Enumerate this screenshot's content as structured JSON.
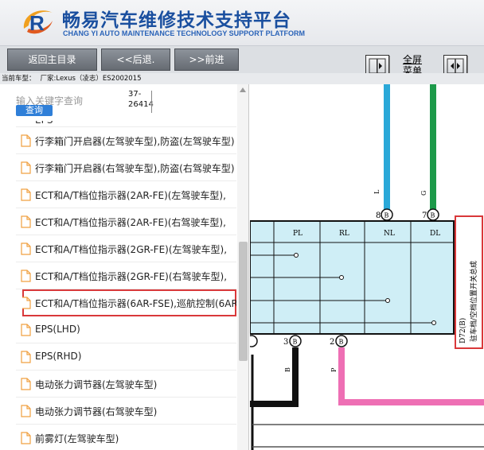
{
  "header": {
    "title_cn": "畅易汽车维修技术支持平台",
    "title_en": "CHANG YI AUTO MAINTENANCE TECHNOLOGY SUPPORT PLATFORM"
  },
  "toolbar": {
    "back_home": "返回主目录",
    "back": "<<后退.",
    "forward": ">>前进",
    "fullscreen_line1": "全屏",
    "fullscreen_line2": "菜单"
  },
  "vehicle": {
    "label": "当前车型：",
    "maker": "厂家:Lexus（凌志）ES2002015"
  },
  "search": {
    "placeholder": "输入关键字查询",
    "value_line1": "37-",
    "value_line2": "26414",
    "button": "查询"
  },
  "list_items": [
    "行李箱门开启器(左驾驶车型),防盗(左驾驶车型)",
    "行李箱门开启器(右驾驶车型),防盗(右驾驶车型)",
    "ECT和A/T档位指示器(2AR-FE)(左驾驶车型),",
    "ECT和A/T档位指示器(2AR-FE)(右驾驶车型),",
    "ECT和A/T档位指示器(2GR-FE)(左驾驶车型),",
    "ECT和A/T档位指示器(2GR-FE)(右驾驶车型),",
    "ECT和A/T档位指示器(6AR-FSE),巡航控制(6AR",
    "EPS(LHD)",
    "EPS(RHD)",
    "电动张力调节器(左驾驶车型)",
    "电动张力调节器(右驾驶车型)",
    "前雾灯(左驾驶车型)"
  ],
  "selected_index": 6,
  "diagram": {
    "pin8": "8",
    "pin7": "7",
    "pin3": "3",
    "pin2": "2",
    "pin_circle": "B",
    "wire_blue": "L",
    "wire_green": "G",
    "wire_black": "B",
    "wire_pink": "P",
    "col_pl": "PL",
    "col_rl": "RL",
    "col_nl": "NL",
    "col_dl": "DL",
    "component_code": "D72(B)",
    "component_name": "驻车档/空档位置开关总成"
  },
  "colors": {
    "brand": "#1a4f9f",
    "highlight": "#d9383a",
    "wire_blue": "#2aa8d8",
    "wire_green": "#1d9a4a",
    "wire_pink": "#ee6fb4",
    "switch_fill": "#cfeef6"
  }
}
